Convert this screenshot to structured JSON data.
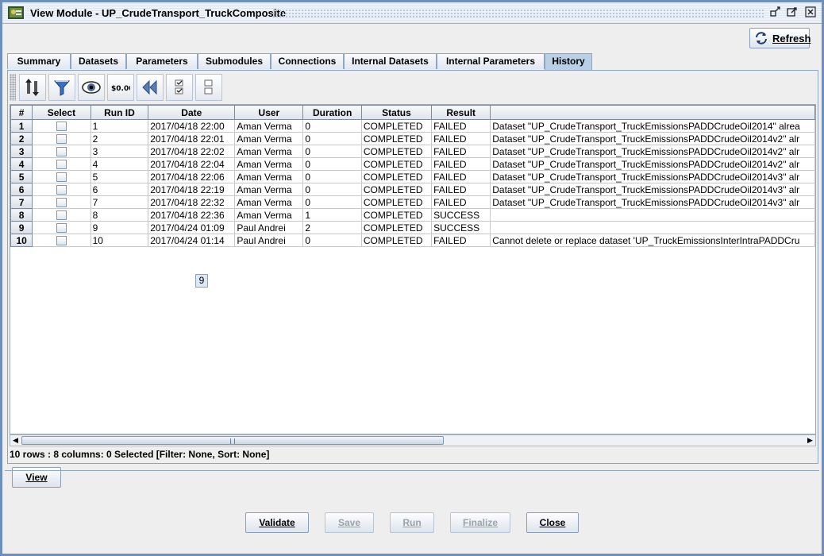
{
  "window": {
    "title": "View Module - UP_CrudeTransport_TruckComposite"
  },
  "header": {
    "refresh_label": "Refresh"
  },
  "tabs": [
    {
      "label": "Summary"
    },
    {
      "label": "Datasets"
    },
    {
      "label": "Parameters"
    },
    {
      "label": "Submodules"
    },
    {
      "label": "Connections"
    },
    {
      "label": "Internal Datasets"
    },
    {
      "label": "Internal Parameters"
    },
    {
      "label": "History",
      "active": true
    }
  ],
  "table": {
    "columns": [
      "#",
      "Select",
      "Run ID",
      "Date",
      "User",
      "Duration",
      "Status",
      "Result",
      ""
    ],
    "rows": [
      {
        "num": "1",
        "run_id": "1",
        "date": "2017/04/18 22:00",
        "user": "Aman Verma",
        "duration": "0",
        "status": "COMPLETED",
        "result": "FAILED",
        "message": "Dataset \"UP_CrudeTransport_TruckEmissionsPADDCrudeOil2014\" alrea"
      },
      {
        "num": "2",
        "run_id": "2",
        "date": "2017/04/18 22:01",
        "user": "Aman Verma",
        "duration": "0",
        "status": "COMPLETED",
        "result": "FAILED",
        "message": "Dataset \"UP_CrudeTransport_TruckEmissionsPADDCrudeOil2014v2\" alr"
      },
      {
        "num": "3",
        "run_id": "3",
        "date": "2017/04/18 22:02",
        "user": "Aman Verma",
        "duration": "0",
        "status": "COMPLETED",
        "result": "FAILED",
        "message": "Dataset \"UP_CrudeTransport_TruckEmissionsPADDCrudeOil2014v2\" alr"
      },
      {
        "num": "4",
        "run_id": "4",
        "date": "2017/04/18 22:04",
        "user": "Aman Verma",
        "duration": "0",
        "status": "COMPLETED",
        "result": "FAILED",
        "message": "Dataset \"UP_CrudeTransport_TruckEmissionsPADDCrudeOil2014v2\" alr"
      },
      {
        "num": "5",
        "run_id": "5",
        "date": "2017/04/18 22:06",
        "user": "Aman Verma",
        "duration": "0",
        "status": "COMPLETED",
        "result": "FAILED",
        "message": "Dataset \"UP_CrudeTransport_TruckEmissionsPADDCrudeOil2014v3\" alr"
      },
      {
        "num": "6",
        "run_id": "6",
        "date": "2017/04/18 22:19",
        "user": "Aman Verma",
        "duration": "0",
        "status": "COMPLETED",
        "result": "FAILED",
        "message": "Dataset \"UP_CrudeTransport_TruckEmissionsPADDCrudeOil2014v3\" alr"
      },
      {
        "num": "7",
        "run_id": "7",
        "date": "2017/04/18 22:32",
        "user": "Aman Verma",
        "duration": "0",
        "status": "COMPLETED",
        "result": "FAILED",
        "message": "Dataset \"UP_CrudeTransport_TruckEmissionsPADDCrudeOil2014v3\" alr"
      },
      {
        "num": "8",
        "run_id": "8",
        "date": "2017/04/18 22:36",
        "user": "Aman Verma",
        "duration": "1",
        "status": "COMPLETED",
        "result": "SUCCESS",
        "message": ""
      },
      {
        "num": "9",
        "run_id": "9",
        "date": "2017/04/24 01:09",
        "user": "Paul Andrei",
        "duration": "2",
        "status": "COMPLETED",
        "result": "SUCCESS",
        "message": ""
      },
      {
        "num": "10",
        "run_id": "10",
        "date": "2017/04/24 01:14",
        "user": "Paul Andrei",
        "duration": "0",
        "status": "COMPLETED",
        "result": "FAILED",
        "message": "Cannot delete or replace dataset 'UP_TruckEmissionsInterIntraPADDCru"
      }
    ],
    "tooltip": "9"
  },
  "status_line": "10 rows : 8 columns: 0 Selected [Filter: None, Sort: None]",
  "buttons": {
    "view": "View",
    "validate": "Validate",
    "save": "Save",
    "run": "Run",
    "finalize": "Finalize",
    "close": "Close"
  }
}
